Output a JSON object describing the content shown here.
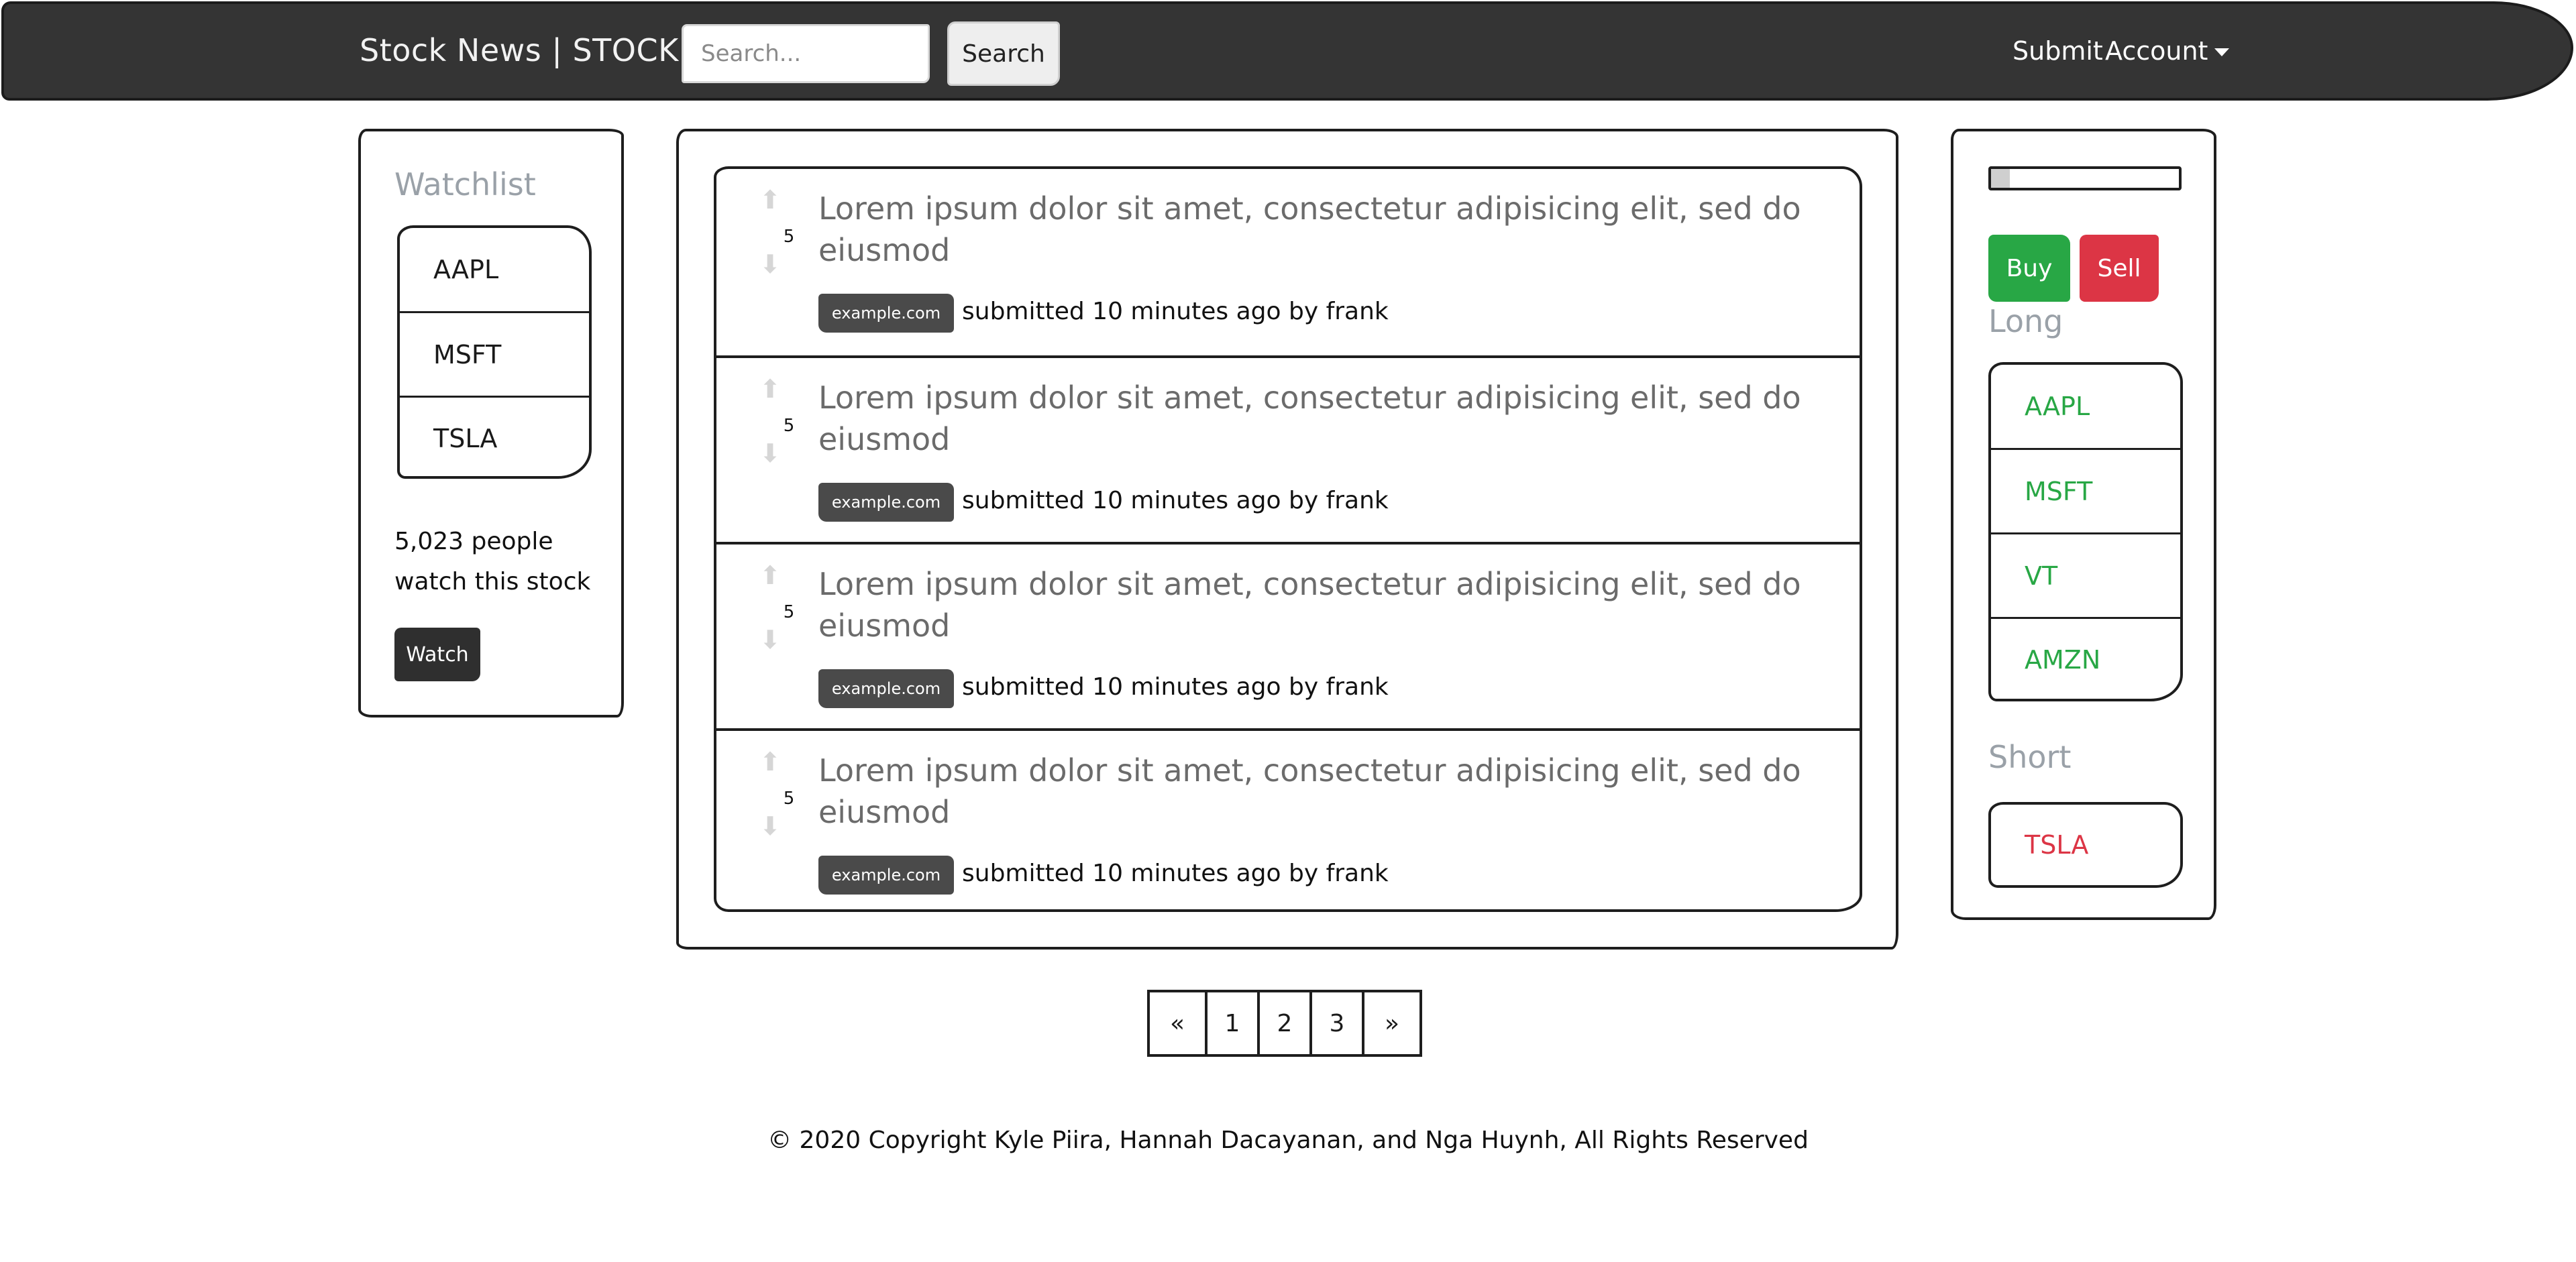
{
  "navbar": {
    "brand": "Stock News | STOCK",
    "search_placeholder": "Search...",
    "search_button": "Search",
    "submit_link": "Submit",
    "account_link": "Account"
  },
  "watchlist": {
    "heading": "Watchlist",
    "items": [
      "AAPL",
      "MSFT",
      "TSLA"
    ],
    "watch_count_text": "5,023 people watch this stock",
    "watch_button": "Watch"
  },
  "posts": [
    {
      "votes": "5",
      "title": "Lorem ipsum dolor sit amet, consectetur adipisicing elit, sed do eiusmod",
      "domain": "example.com",
      "meta": "submitted 10 minutes ago by frank"
    },
    {
      "votes": "5",
      "title": "Lorem ipsum dolor sit amet, consectetur adipisicing elit, sed do eiusmod",
      "domain": "example.com",
      "meta": "submitted 10 minutes ago by frank"
    },
    {
      "votes": "5",
      "title": "Lorem ipsum dolor sit amet, consectetur adipisicing elit, sed do eiusmod",
      "domain": "example.com",
      "meta": "submitted 10 minutes ago by frank"
    },
    {
      "votes": "5",
      "title": "Lorem ipsum dolor sit amet, consectetur adipisicing elit, sed do eiusmod",
      "domain": "example.com",
      "meta": "submitted 10 minutes ago by frank"
    }
  ],
  "trade": {
    "progress_fraction": 0.1,
    "buy_button": "Buy",
    "sell_button": "Sell",
    "long_heading": "Long",
    "long_items": [
      "AAPL",
      "MSFT",
      "VT",
      "AMZN"
    ],
    "short_heading": "Short",
    "short_items": [
      "TSLA"
    ]
  },
  "pagination": {
    "prev": "«",
    "pages": [
      "1",
      "2",
      "3"
    ],
    "next": "»"
  },
  "footer": {
    "copyright": "© 2020 Copyright Kyle Piira, Hannah Dacayanan, and Nga Huynh, All Rights Reserved"
  },
  "colors": {
    "navbar_bg": "#343434",
    "buy": "#28a745",
    "sell": "#dc3545",
    "heading_muted": "#9aa1a8"
  },
  "icons": {
    "upvote": "arrow-up-icon",
    "downvote": "arrow-down-icon",
    "account_caret": "caret-down-icon"
  }
}
